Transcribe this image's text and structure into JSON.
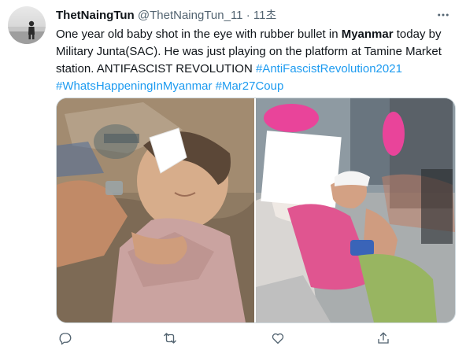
{
  "tweet": {
    "display_name": "ThetNaingTun",
    "handle": "@ThetNaingTun_11",
    "separator": "·",
    "time": "11초",
    "text": {
      "p1": "One year old baby shot in the eye with rubber bullet in ",
      "bold": "Myanmar",
      "p2": " today by Military Junta(SAC). He was just playing on the platform at Tamine Market station. ANTIFASCIST REVOLUTION ",
      "tag1": "#AntiFascistRevolution2021",
      "tag2": "#WhatsHappeningInMyanmar",
      "tag3": "#Mar27Coup"
    }
  },
  "icons": {
    "more": "more-dots-icon",
    "reply": "reply-icon",
    "retweet": "retweet-icon",
    "like": "heart-icon",
    "share": "share-icon"
  },
  "colors": {
    "link": "#1d9bf0",
    "secondary_text": "#536471",
    "border": "#cfd9de"
  }
}
